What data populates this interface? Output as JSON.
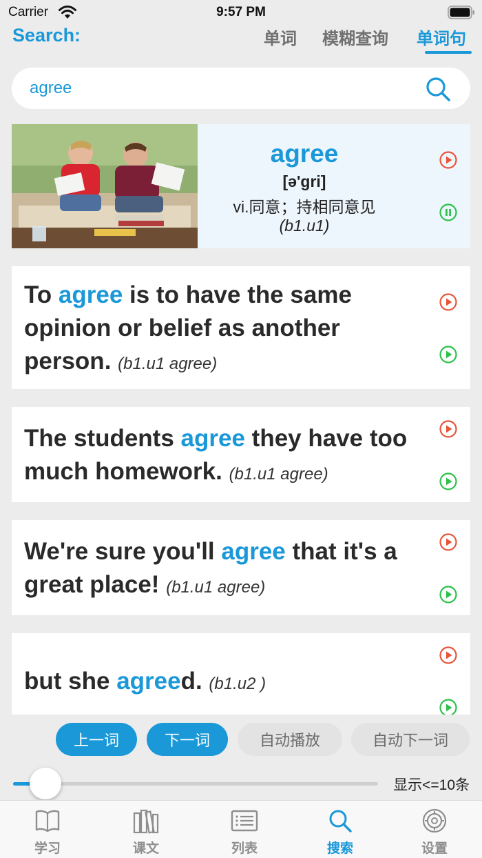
{
  "status_bar": {
    "carrier": "Carrier",
    "time": "9:57 PM"
  },
  "header": {
    "title": "Search:",
    "tabs": [
      {
        "label": "单词"
      },
      {
        "label": "模糊查询"
      },
      {
        "label": "单词句"
      }
    ],
    "active_tab": "单词句"
  },
  "search": {
    "value": "agree",
    "icon": "search-icon"
  },
  "word_card": {
    "word": "agree",
    "phonetic": "[ə'gri]",
    "meaning": "vi.同意；持相同意见",
    "source": "(b1.u1)",
    "image": "two students reading papers on a couch",
    "audio_icons": [
      "play-red-icon",
      "pause-green-icon"
    ]
  },
  "sentences": [
    {
      "before": "To ",
      "highlight": "agree",
      "after": " is to have the same opinion or belief as another person. ",
      "source": "(b1.u1 agree)"
    },
    {
      "before": "The students ",
      "highlight": "agree",
      "after": " they have too much homework. ",
      "source": "(b1.u1 agree)"
    },
    {
      "before": "We're sure you'll ",
      "highlight": "agree",
      "after": " that it's a great place! ",
      "source": "(b1.u1 agree)"
    },
    {
      "before": "but she ",
      "highlight": "agree",
      "after": "d. ",
      "source": "(b1.u2 )"
    }
  ],
  "controls": {
    "prev_word": "上一词",
    "next_word": "下一词",
    "auto_play": "自动播放",
    "auto_next": "自动下一词"
  },
  "slider": {
    "label": "显示<=10条",
    "value_fraction": 0.07
  },
  "tabbar": {
    "items": [
      {
        "label": "学习",
        "icon": "book-icon"
      },
      {
        "label": "课文",
        "icon": "books-icon"
      },
      {
        "label": "列表",
        "icon": "list-icon"
      },
      {
        "label": "搜索",
        "icon": "search-icon"
      },
      {
        "label": "设置",
        "icon": "gear-icon"
      }
    ],
    "active": "搜索"
  },
  "colors": {
    "accent": "#1a98d8",
    "play_red": "#e8553a",
    "play_green": "#2cc14a",
    "background": "#ececec"
  }
}
